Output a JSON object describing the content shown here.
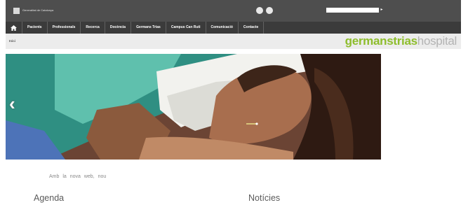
{
  "topbar": {
    "gencat_text": "Generalitat de Catalunya",
    "share_icons": [
      "social-icon",
      "social-icon"
    ],
    "search_button": "▸"
  },
  "nav": {
    "home_icon": "home-icon",
    "items": [
      "Pacients",
      "Professionals",
      "Recerca",
      "Docència",
      "Germans Trias",
      "Campus Can Ruti",
      "Comunicació",
      "Contacte"
    ]
  },
  "breadcrumb": "Inici",
  "logo": {
    "part_a": "germanstrias",
    "part_b": "hospital"
  },
  "slider": {
    "prev_icon": "chevron-left-icon"
  },
  "intro_text": "Amb la nova web, nou",
  "sections": {
    "agenda": "Agenda",
    "news": "Notícies"
  },
  "colors": {
    "topbar": "#4e4e4e",
    "nav": "#3b3b3b",
    "logo_green": "#8ebd2c",
    "logo_grey": "#b3b3b3"
  }
}
